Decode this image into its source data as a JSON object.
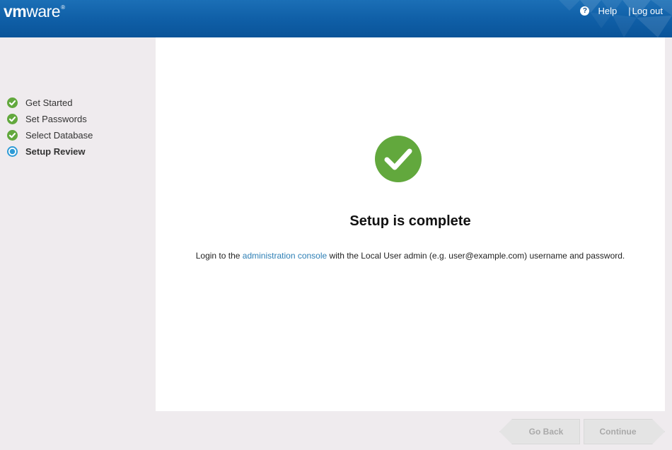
{
  "header": {
    "logo_vm": "vm",
    "logo_ware": "ware",
    "logo_reg": "®",
    "help_label": "Help",
    "separator": "|",
    "logout_label": "Log out",
    "help_icon_glyph": "?"
  },
  "sidebar": {
    "steps": [
      {
        "label": "Get Started",
        "status": "complete",
        "icon": "check-circle-icon"
      },
      {
        "label": "Set Passwords",
        "status": "complete",
        "icon": "check-circle-icon"
      },
      {
        "label": "Select Database",
        "status": "complete",
        "icon": "check-circle-icon"
      },
      {
        "label": "Setup Review",
        "status": "current",
        "icon": "current-step-icon"
      }
    ]
  },
  "main": {
    "title": "Setup is complete",
    "message_prefix": "Login to the ",
    "message_link": "administration console",
    "message_suffix": " with the Local User admin (e.g. user@example.com) username and password."
  },
  "footer": {
    "back_label": "Go Back",
    "continue_label": "Continue"
  },
  "colors": {
    "header_blue": "#0f5ea6",
    "success_green": "#62a83d",
    "current_blue": "#2f9bd6",
    "link_blue": "#2d7fb5",
    "disabled_text": "#a9a9a9"
  }
}
